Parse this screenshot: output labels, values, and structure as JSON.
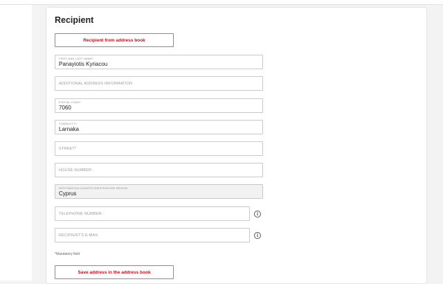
{
  "section": {
    "title": "Recipient"
  },
  "buttons": {
    "address_book": "Recipient from address book",
    "save_address": "Save address in the address book"
  },
  "fields": {
    "name": {
      "label": "FIRST AND LAST NAME*",
      "value": "Panayiotis Kyriacou"
    },
    "additional": {
      "placeholder": "ADDITIONAL ADDRESS INFORMATION"
    },
    "postal": {
      "label": "POSTAL CODE*",
      "value": "7060"
    },
    "town": {
      "label": "TOWN/CITY*",
      "value": "Larnaka"
    },
    "street": {
      "placeholder": "STREET*"
    },
    "house": {
      "placeholder": "HOUSE NUMBER"
    },
    "country": {
      "label": "DESTINATION COUNTRY/DESTINATION REGION",
      "value": "Cyprus"
    },
    "phone": {
      "placeholder": "TELEPHONE NUMBER"
    },
    "email": {
      "placeholder": "RECIPIENT'S E-MAIL"
    }
  },
  "info_icon_glyph": "i",
  "note": "*Mandatory field",
  "colors": {
    "accent": "#d40511",
    "border": "#c8c8c8",
    "background": "#f3f3f3"
  }
}
